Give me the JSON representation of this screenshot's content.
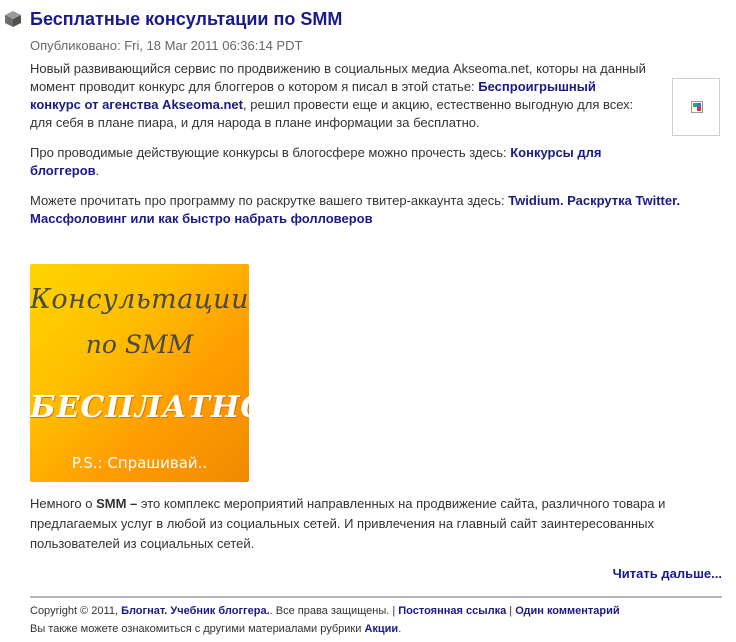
{
  "post": {
    "title": "Бесплатные консультации по SMM",
    "meta": "Опубликовано: Fri, 18 Mar 2011 06:36:14 PDT",
    "p1_a": "Новый развивающийся сервис по продвижению в социальных медиа Akseoma.net, которы на данный момент проводит конкурс для блоггеров о котором я писал в этой статье: ",
    "p1_link": "Беспроигрышный конкурс от агенства Akseoma.net",
    "p1_b": ", решил провести еще и акцию, естественно выгодную для всех: для себя в плане пиара, и для народа в плане информации за бесплатно.",
    "p2_a": "Про проводимые действующие конкурсы в блогосфере можно прочесть здесь: ",
    "p2_link": "Конкурсы для блоггеров",
    "p2_b": ".",
    "p3_a": "Можете прочитать про программу по раскрутке вашего твитер-аккаунта здесь: ",
    "p3_link": "Twidium. Раскрутка Twitter. Массфоловинг или как быстро набрать фолловеров",
    "promo": {
      "line1": "Консультации",
      "line2": "по SMM",
      "line3": "БЕСПЛАТНО",
      "line4": "P.S.: Спрашивай.."
    },
    "after_a": "Немного о ",
    "after_bold": "SMM –",
    "after_b": " это комплекс мероприятий направленных на продвижение сайта, различного товара и предлагаемых услуг в любой из социальных сетей. И привлечения на главный сайт заинтересованных пользователей из социальных сетей.",
    "read_more": "Читать дальше..."
  },
  "footer": {
    "copyright": "Copyright © 2011, ",
    "site_link": "Блогнат. Учебник блоггера.",
    "rights": ". Все права защищены. | ",
    "permalink": "Постоянная ссылка",
    "sep": " | ",
    "comments": "Один комментарий",
    "also": "Вы также можете ознакомиться с другими материалами рубрики ",
    "category": "Акции",
    "dot": "."
  },
  "colors": {
    "link": "#1a1a8a",
    "promo_gradient_start": "#ffd400",
    "promo_gradient_end": "#f08a00"
  }
}
